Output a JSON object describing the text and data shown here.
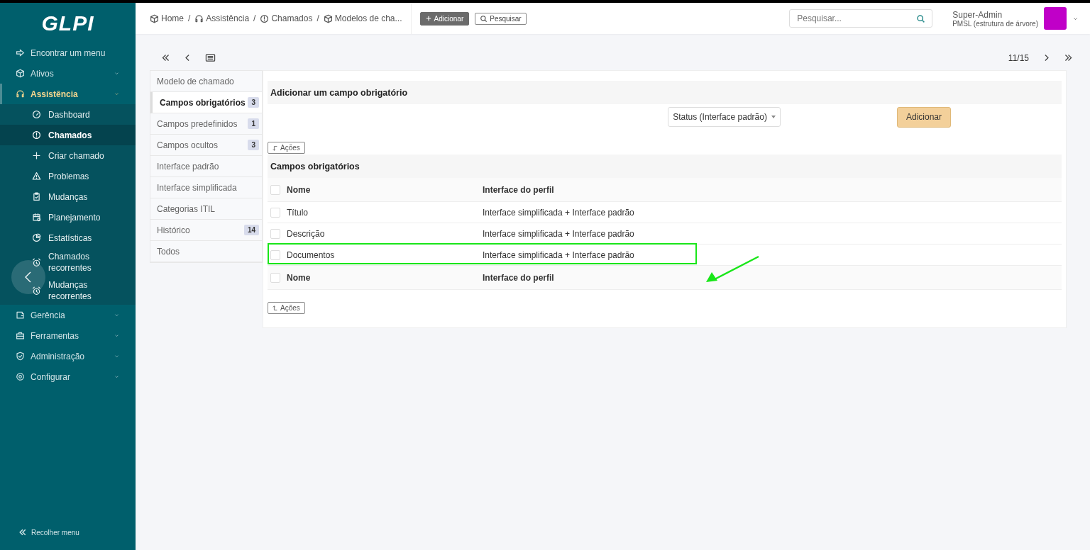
{
  "logo": "GLPI",
  "sidebar": {
    "find": "Encontrar um menu",
    "items": [
      {
        "label": "Ativos",
        "selected": false
      },
      {
        "label": "Assistência",
        "selected": true,
        "children": [
          {
            "label": "Dashboard",
            "selected": false
          },
          {
            "label": "Chamados",
            "selected": true
          },
          {
            "label": "Criar chamado",
            "selected": false
          },
          {
            "label": "Problemas",
            "selected": false
          },
          {
            "label": "Mudanças",
            "selected": false
          },
          {
            "label": "Planejamento",
            "selected": false
          },
          {
            "label": "Estatísticas",
            "selected": false
          },
          {
            "label": "Chamados recorrentes",
            "selected": false
          },
          {
            "label": "Mudanças recorrentes",
            "selected": false
          }
        ]
      },
      {
        "label": "Gerência",
        "selected": false
      },
      {
        "label": "Ferramentas",
        "selected": false
      },
      {
        "label": "Administração",
        "selected": false
      },
      {
        "label": "Configurar",
        "selected": false
      }
    ],
    "collapse": "Recolher menu"
  },
  "breadcrumb": {
    "separator": "/",
    "items": [
      "Home",
      "Assistência",
      "Chamados",
      "Modelos de cha..."
    ]
  },
  "header_buttons": {
    "add": "Adicionar",
    "search": "Pesquisar"
  },
  "search": {
    "placeholder": "Pesquisar..."
  },
  "user": {
    "name": "Super-Admin",
    "entity": "PMSL (estrutura de árvore)"
  },
  "pager": {
    "position": "11/15"
  },
  "tabs": [
    {
      "label": "Modelo de chamado",
      "selected": false
    },
    {
      "label": "Campos obrigatórios",
      "count": "3",
      "selected": true
    },
    {
      "label": "Campos predefinidos",
      "count": "1",
      "selected": false
    },
    {
      "label": "Campos ocultos",
      "count": "3",
      "selected": false
    },
    {
      "label": "Interface padrão",
      "selected": false
    },
    {
      "label": "Interface simplificada",
      "selected": false
    },
    {
      "label": "Categorias ITIL",
      "selected": false
    },
    {
      "label": "Histórico",
      "count": "14",
      "selected": false
    },
    {
      "label": "Todos",
      "selected": false
    }
  ],
  "add_section": {
    "title": "Adicionar um campo obrigatório",
    "field_value": "Status (Interface padrão)",
    "button": "Adicionar"
  },
  "actions_top": "Ações",
  "table": {
    "title": "Campos obrigatórios",
    "columns": [
      "Nome",
      "Interface do perfil"
    ],
    "rows": [
      {
        "cells": [
          "Título",
          "Interface simplificada + Interface padrão"
        ],
        "checked": false,
        "highlighted": false
      },
      {
        "cells": [
          "Descrição",
          "Interface simplificada + Interface padrão"
        ],
        "checked": false,
        "highlighted": false
      },
      {
        "cells": [
          "Documentos",
          "Interface simplificada + Interface padrão"
        ],
        "checked": false,
        "highlighted": true
      }
    ],
    "header_checked": false,
    "footer_columns": [
      "Nome",
      "Interface do perfil"
    ],
    "footer_checked": false
  },
  "actions_bottom": "Ações"
}
